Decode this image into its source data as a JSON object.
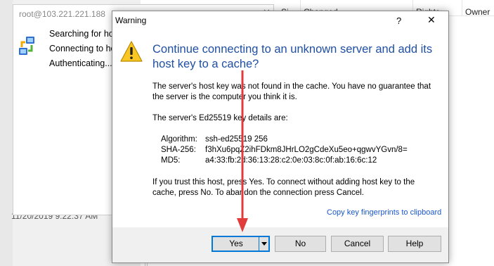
{
  "background": {
    "columns": [
      "Si",
      "Changed",
      "Rights",
      "Owner"
    ],
    "bottom_date": "11/20/2019  9:22:37 AM"
  },
  "connecting": {
    "title": "root@103.221.221.188",
    "close": "✕",
    "lines": [
      "Searching for hos",
      "Connecting to ho",
      "Authenticating..."
    ]
  },
  "warning": {
    "title": "Warning",
    "help": "?",
    "close": "✕",
    "heading": "Continue connecting to an unknown server and add its host key to a cache?",
    "paragraph1": "The server's host key was not found in the cache. You have no guarantee that the server is the computer you think it is.",
    "paragraph2": "The server's Ed25519 key details are:",
    "details": [
      {
        "key": "Algorithm:",
        "value": "ssh-ed25519 256"
      },
      {
        "key": "SHA-256:",
        "value": "f3hXu6pqZ2ihFDkm8JHrLO2gCdeXu5eo+qgwvYGvn/8="
      },
      {
        "key": "MD5:",
        "value": "a4:33:fb:2d:36:13:28:c2:0e:03:8c:0f:ab:16:6c:12"
      }
    ],
    "paragraph3": "If you trust this host, press Yes. To connect without adding host key to the cache, press No. To abandon the connection press Cancel.",
    "copy_link": "Copy key fingerprints to clipboard",
    "buttons": {
      "yes": "Yes",
      "no": "No",
      "cancel": "Cancel",
      "help": "Help"
    }
  },
  "colors": {
    "heading": "#1f4fa3",
    "link": "#1a57c9",
    "arrow": "#e03c3c",
    "focus": "#0078d7"
  }
}
